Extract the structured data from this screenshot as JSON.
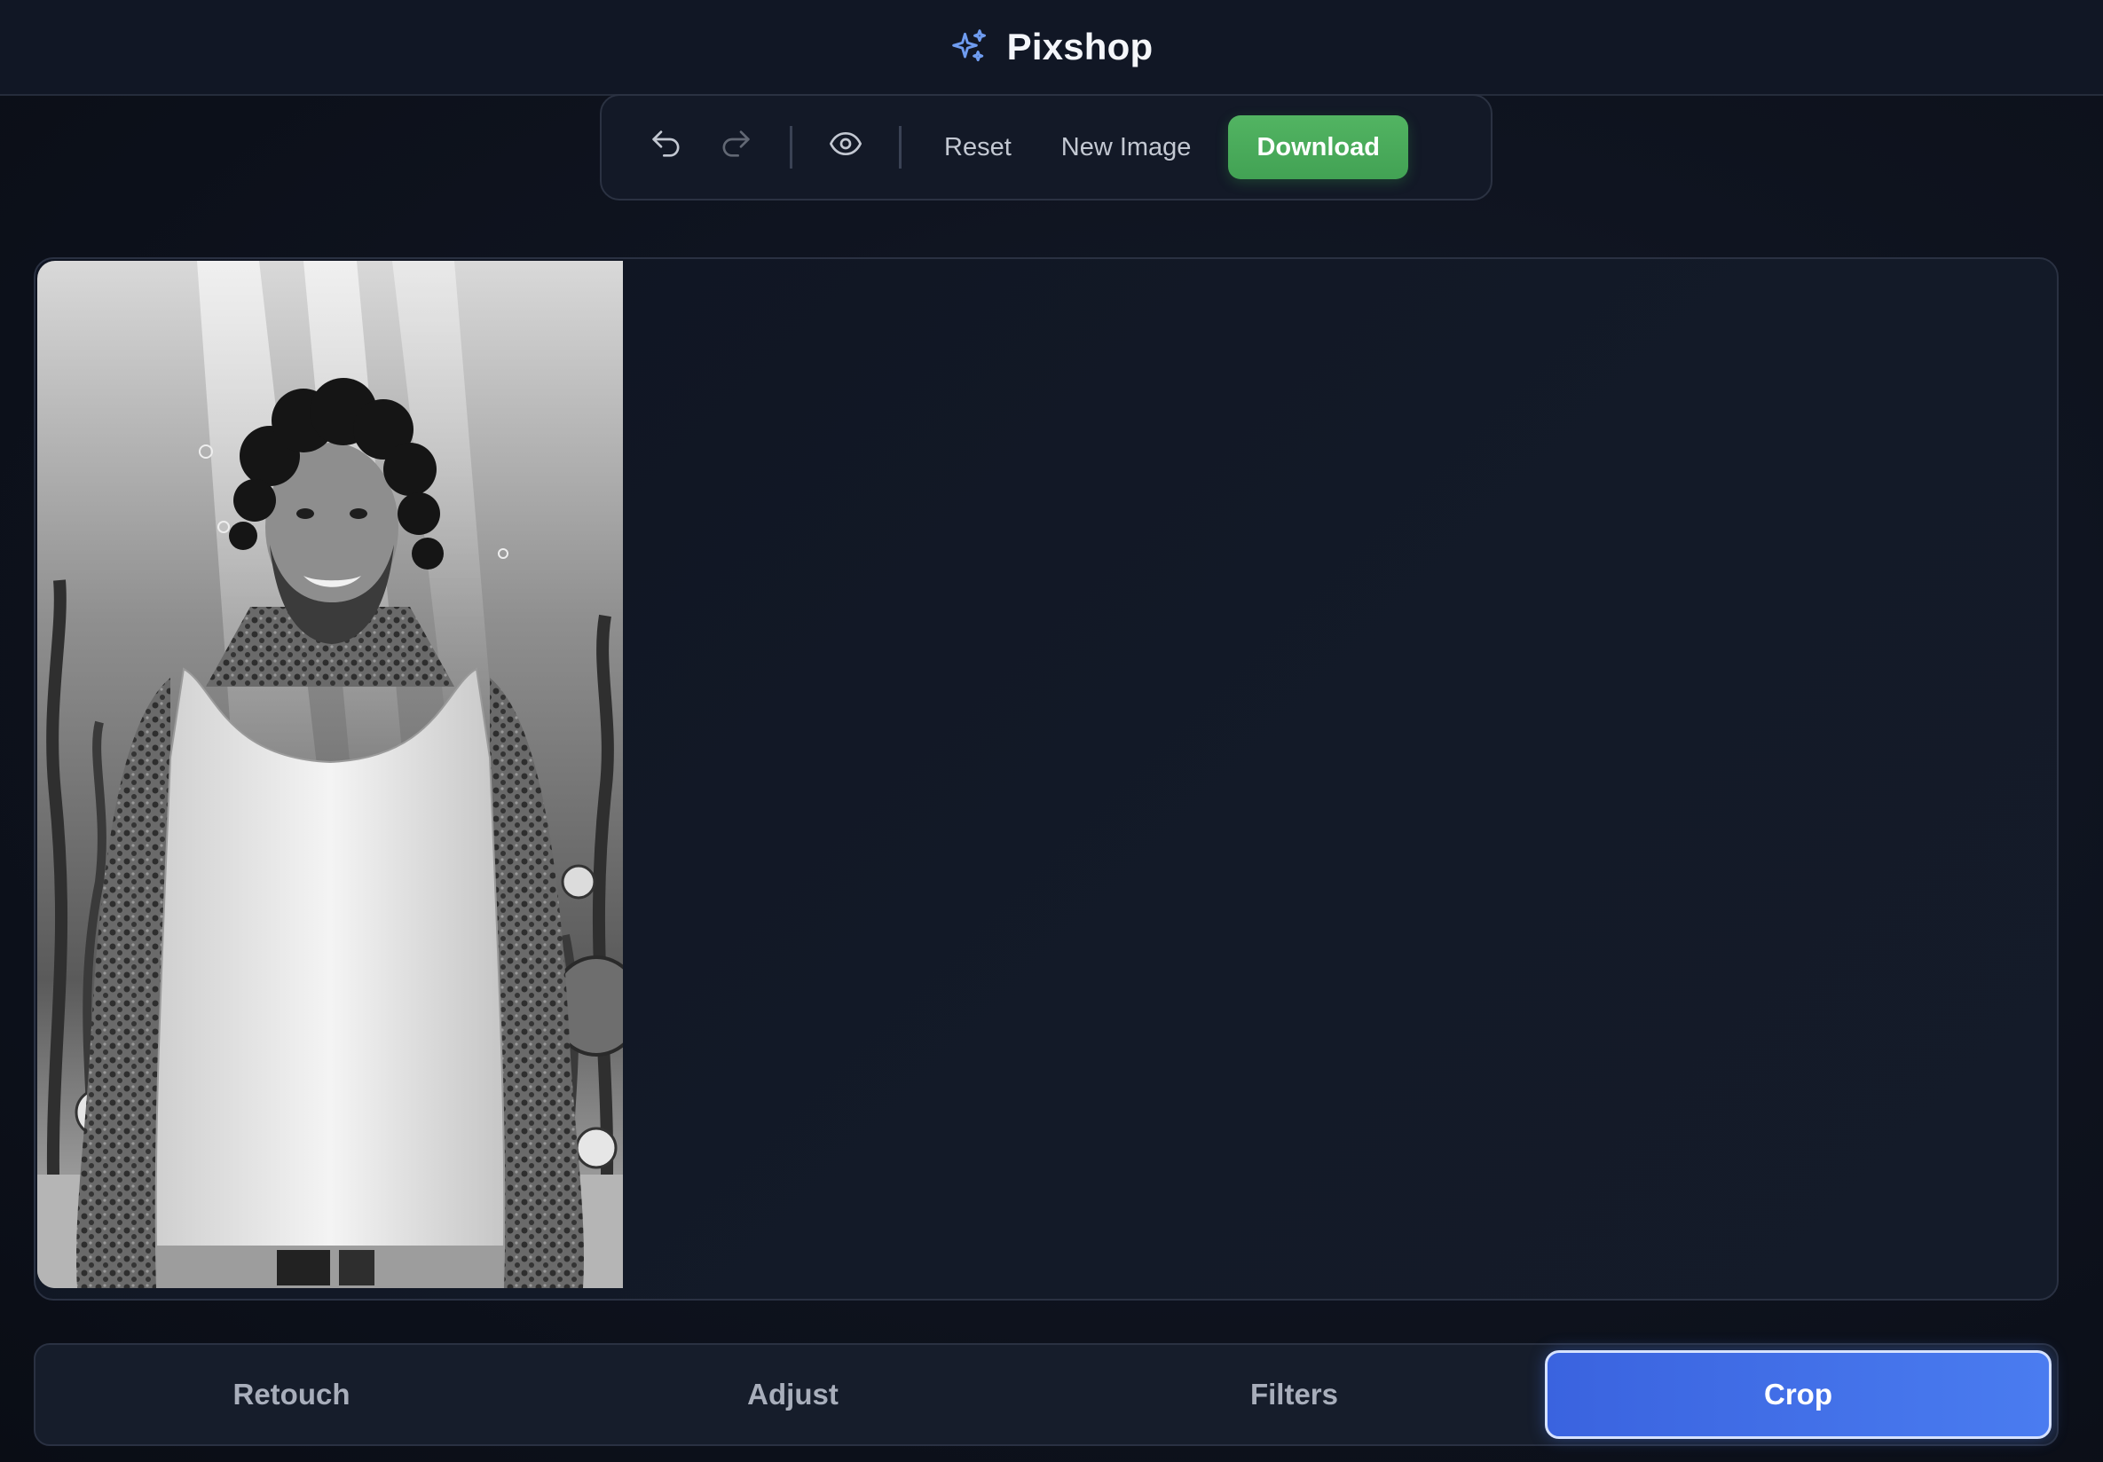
{
  "app": {
    "title": "Pixshop",
    "icon": "sparkles-icon",
    "accent_color": "#6f9cf0"
  },
  "toolbar": {
    "undo_icon": "undo-icon",
    "redo_icon": "redo-icon",
    "compare_icon": "eye-icon",
    "reset_label": "Reset",
    "new_image_label": "New Image",
    "download_label": "Download",
    "download_color": "#4caf5c"
  },
  "canvas": {
    "image_description_icon": "edited-photo"
  },
  "tabs": [
    {
      "label": "Retouch",
      "active": false
    },
    {
      "label": "Adjust",
      "active": false
    },
    {
      "label": "Filters",
      "active": false
    },
    {
      "label": "Crop",
      "active": true
    }
  ],
  "colors": {
    "active_tab": "#4271e8",
    "background": "#0e131e"
  }
}
